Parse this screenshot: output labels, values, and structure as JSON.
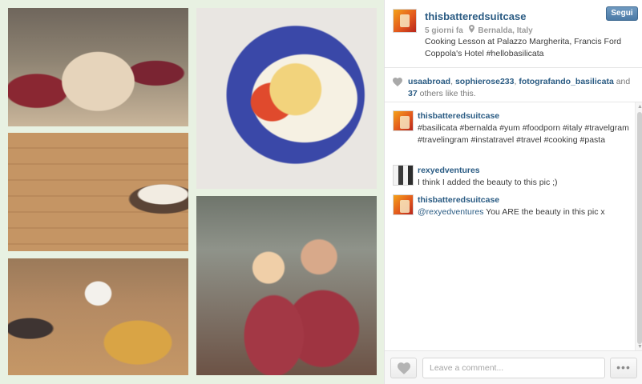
{
  "post": {
    "username": "thisbatteredsuitcase",
    "time_ago": "5 giorni fa",
    "location": "Bernalda, Italy",
    "caption": "Cooking Lesson at Palazzo Margherita, Francis Ford Coppola's Hotel #hellobasilicata",
    "follow_label": "Segui",
    "location_icon": "map-pin-icon"
  },
  "photo": {
    "tiles": [
      {
        "name": "cooking-class-group"
      },
      {
        "name": "pasta-dish-closeup"
      },
      {
        "name": "pasta-shapes-on-board"
      },
      {
        "name": "gnocchi-on-table"
      },
      {
        "name": "couple-with-plates"
      }
    ]
  },
  "likes": {
    "users": [
      "usaabroad",
      "sophierose233",
      "fotografando_basilicata"
    ],
    "sep1": ", ",
    "sep2": ", ",
    "and_text": " and ",
    "others_count": "37",
    "others_text": " others like this."
  },
  "comments": [
    {
      "username": "thisbatteredsuitcase",
      "text": "#basilicata #bernalda #yum #foodporn #italy #travelgram #travelingram #instatravel #travel #cooking #pasta"
    },
    {
      "username": "rexyedventures",
      "text": "I think I added the beauty to this pic ;)"
    },
    {
      "username": "thisbatteredsuitcase",
      "mention": "@rexyedventures",
      "text": " You ARE the beauty in this pic x"
    }
  ],
  "footer": {
    "comment_placeholder": "Leave a comment...",
    "more_label": "•••"
  },
  "colors": {
    "link": "#2a5b83",
    "follow_button": "#4b7aa6",
    "collage_border": "#e8f1e2"
  }
}
